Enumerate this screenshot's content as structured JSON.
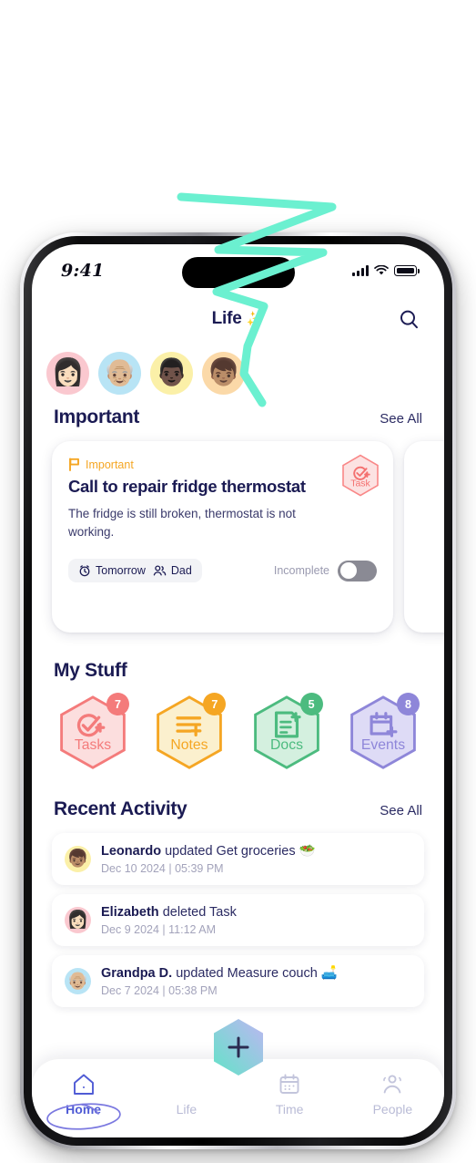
{
  "status_bar": {
    "time": "9:41",
    "signal_icon": "cellular-bars-icon",
    "wifi_icon": "wifi-icon",
    "battery_icon": "battery-full-icon"
  },
  "header": {
    "title": "Life",
    "sparkle": "✨",
    "search_icon": "search-icon"
  },
  "avatars": [
    {
      "name": "avatar-elizabeth",
      "emoji": "👩🏻",
      "bg": "#FAC8CF"
    },
    {
      "name": "avatar-grandpa",
      "emoji": "👴🏼",
      "bg": "#B8E4F5"
    },
    {
      "name": "avatar-dad",
      "emoji": "👨🏿",
      "bg": "#FBF0A8"
    },
    {
      "name": "avatar-leonardo",
      "emoji": "👦🏽",
      "bg": "#FBD9A8"
    }
  ],
  "important": {
    "title": "Important",
    "see_all": "See All",
    "card": {
      "flag_label": "Important",
      "flag_icon": "flag-icon",
      "title": "Call to repair fridge thermostat",
      "description": "The fridge is still broken, thermostat is not working.",
      "due": "Tomorrow",
      "due_icon": "alarm-clock-icon",
      "assignee": "Dad",
      "assignee_icon": "people-icon",
      "status_label": "Incomplete",
      "toggle_state": "off",
      "badge_label": "Task",
      "badge_icon": "task-check-plus-icon",
      "badge_color": "#F98787"
    }
  },
  "my_stuff": {
    "title": "My Stuff",
    "items": [
      {
        "label": "Tasks",
        "count": "7",
        "icon": "task-check-plus-icon",
        "color": "#F47B7B",
        "fill": "#FCDEDE"
      },
      {
        "label": "Notes",
        "count": "7",
        "icon": "note-lines-plus-icon",
        "color": "#F5A623",
        "fill": "#FBF0CE"
      },
      {
        "label": "Docs",
        "count": "5",
        "icon": "doc-plus-icon",
        "color": "#4CBB7F",
        "fill": "#D4F0DF"
      },
      {
        "label": "Events",
        "count": "8",
        "icon": "calendar-plus-icon",
        "color": "#8E86D9",
        "fill": "#DEDBF6"
      }
    ]
  },
  "recent_activity": {
    "title": "Recent Activity",
    "see_all": "See All",
    "items": [
      {
        "user": "Leonardo",
        "action": "updated Get groceries 🥗",
        "time": "Dec 10 2024 | 05:39 PM",
        "emoji": "👦🏽",
        "bg": "#FBF0A8"
      },
      {
        "user": "Elizabeth",
        "action": "deleted Task",
        "time": "Dec 9 2024 | 11:12 AM",
        "emoji": "👩🏻",
        "bg": "#FAC8CF"
      },
      {
        "user": "Grandpa D.",
        "action": "updated Measure couch 🛋️",
        "time": "Dec 7 2024 | 05:38 PM",
        "emoji": "👴🏼",
        "bg": "#B8E4F5"
      }
    ]
  },
  "tabbar": {
    "fab_icon": "plus-icon",
    "tabs": [
      {
        "label": "Home",
        "icon": "home-icon",
        "active": true
      },
      {
        "label": "Life",
        "icon": "heart-icon",
        "active": false
      },
      {
        "label": "Time",
        "icon": "calendar-icon",
        "active": false
      },
      {
        "label": "People",
        "icon": "people-icon",
        "active": false
      }
    ]
  },
  "annotations": {
    "zigzag_color": "#6BF0D0",
    "home_circle_color": "#7B79E0"
  }
}
